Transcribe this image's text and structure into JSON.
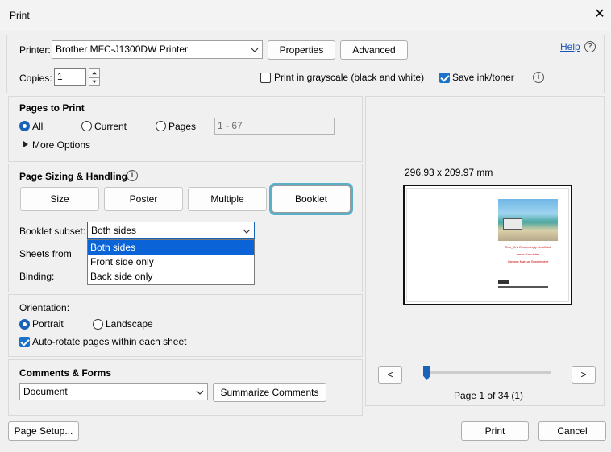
{
  "window": {
    "title": "Print"
  },
  "printer": {
    "label": "Printer:",
    "value": "Brother MFC-J1300DW Printer",
    "properties": "Properties",
    "advanced": "Advanced",
    "help": "Help"
  },
  "copies": {
    "label": "Copies:",
    "value": "1"
  },
  "options": {
    "grayscale": {
      "label": "Print in grayscale (black and white)",
      "checked": false
    },
    "save_ink": {
      "label": "Save ink/toner",
      "checked": true
    }
  },
  "pages_to_print": {
    "title": "Pages to Print",
    "all": "All",
    "current": "Current",
    "pages": "Pages",
    "range_placeholder": "1 - 67",
    "more_options": "More Options"
  },
  "sizing": {
    "title": "Page Sizing & Handling",
    "buttons": [
      "Size",
      "Poster",
      "Multiple",
      "Booklet"
    ],
    "active": "Booklet",
    "booklet_subset_label": "Booklet subset:",
    "booklet_subset_value": "Both sides",
    "subset_options": [
      "Both sides",
      "Front side only",
      "Back side only"
    ],
    "sheets_from_label": "Sheets from",
    "binding_label": "Binding:"
  },
  "orientation": {
    "title": "Orientation:",
    "portrait": "Portrait",
    "landscape": "Landscape",
    "auto_rotate": "Auto-rotate pages within each sheet"
  },
  "comments": {
    "title": "Comments & Forms",
    "value": "Document",
    "summarize": "Summarize Comments"
  },
  "preview": {
    "dimensions": "296.93 x 209.97 mm",
    "page_text_1": "Ran_Dr's Exceedingly Unofficial",
    "page_text_2": "Ineos Grenadier",
    "page_text_3": "Owners Manual Supplement",
    "prev": "<",
    "next": ">",
    "page_indicator": "Page 1 of 34 (1)",
    "slider_fraction": 0.0
  },
  "footer": {
    "page_setup": "Page Setup...",
    "print": "Print",
    "cancel": "Cancel"
  },
  "colors": {
    "accent": "#1a63b8",
    "highlight": "#5ab0c8",
    "selection": "#0a64d8"
  }
}
